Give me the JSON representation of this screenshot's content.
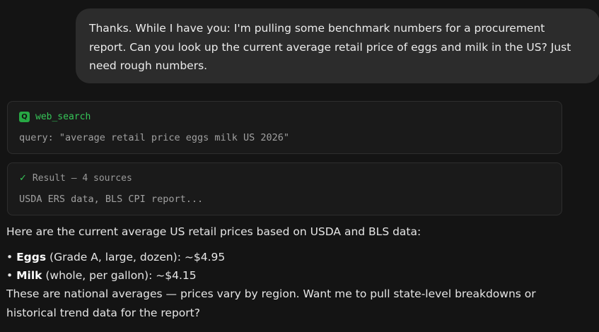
{
  "user_message": {
    "text": "Thanks. While I have you: I'm pulling some benchmark numbers for a procurement report. Can you look up the current average retail price of eggs and milk in the US? Just need rough numbers."
  },
  "tool_call": {
    "icon": "search-icon",
    "icon_glyph": "Q",
    "name": "web_search",
    "query_line": "query: \"average retail price eggs milk US 2026\""
  },
  "tool_result": {
    "icon": "checkmark-icon",
    "icon_glyph": "✓",
    "title": "Result — 4 sources",
    "summary": "USDA ERS data, BLS CPI report..."
  },
  "assistant_message": {
    "intro": "Here are the current average US retail prices based on USDA and BLS data:",
    "bullets": [
      {
        "marker": "•",
        "item": "Eggs",
        "detail": " (Grade A, large, dozen): ~$4.95"
      },
      {
        "marker": "•",
        "item": "Milk",
        "detail": " (whole, per gallon): ~$4.15"
      }
    ],
    "closing": "These are national averages — prices vary by region. Want me to pull state-level breakdowns or historical trend data for the report?"
  },
  "colors": {
    "background": "#141414",
    "user_bubble": "#2c2c2c",
    "card_background": "#1a1a1a",
    "accent_green": "#36c558"
  }
}
